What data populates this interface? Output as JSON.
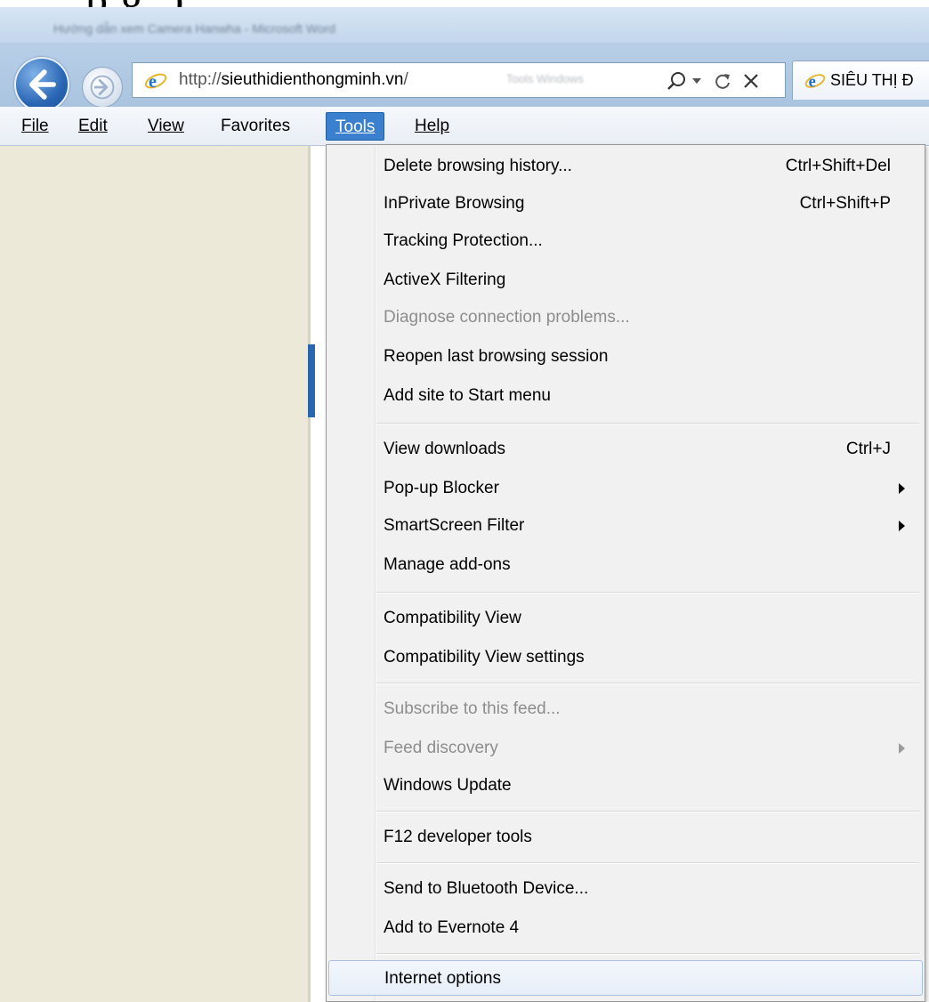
{
  "window": {
    "title": "Hướng dẫn xem Camera Hanwha - Microsoft Word",
    "caption_fragment": "p                                                      g              ;)"
  },
  "address_bar": {
    "url_prefix": "http://",
    "url_domain": "sieuthidienthongminh.vn",
    "url_suffix": "/",
    "blurred_text": "Tools     Windows"
  },
  "tab": {
    "label": "SIÊU THỊ Đ"
  },
  "menubar": {
    "file": "File",
    "edit": "Edit",
    "view": "View",
    "favorites": "Favorites",
    "tools": "Tools",
    "help": "Help"
  },
  "tools_menu": {
    "items": [
      {
        "label": "Delete browsing history...",
        "shortcut": "Ctrl+Shift+Del",
        "disabled": false
      },
      {
        "label": "InPrivate Browsing",
        "shortcut": "Ctrl+Shift+P",
        "disabled": false
      },
      {
        "label": "Tracking Protection...",
        "shortcut": "",
        "disabled": false
      },
      {
        "label": "ActiveX Filtering",
        "shortcut": "",
        "disabled": false
      },
      {
        "label": "Diagnose connection problems...",
        "shortcut": "",
        "disabled": true
      },
      {
        "label": "Reopen last browsing session",
        "shortcut": "",
        "disabled": false
      },
      {
        "label": "Add site to Start menu",
        "shortcut": "",
        "disabled": false
      },
      {
        "label": "View downloads",
        "shortcut": "Ctrl+J",
        "disabled": false
      },
      {
        "label": "Pop-up Blocker",
        "shortcut": "",
        "submenu": true,
        "disabled": false
      },
      {
        "label": "SmartScreen Filter",
        "shortcut": "",
        "submenu": true,
        "disabled": false
      },
      {
        "label": "Manage add-ons",
        "shortcut": "",
        "disabled": false
      },
      {
        "label": "Compatibility View",
        "shortcut": "",
        "disabled": false
      },
      {
        "label": "Compatibility View settings",
        "shortcut": "",
        "disabled": false
      },
      {
        "label": "Subscribe to this feed...",
        "shortcut": "",
        "disabled": true
      },
      {
        "label": "Feed discovery",
        "shortcut": "",
        "submenu": true,
        "disabled": true
      },
      {
        "label": "Windows Update",
        "shortcut": "",
        "disabled": false
      },
      {
        "label": "F12 developer tools",
        "shortcut": "",
        "disabled": false
      },
      {
        "label": "Send to Bluetooth Device...",
        "shortcut": "",
        "disabled": false
      },
      {
        "label": "Add to Evernote 4",
        "shortcut": "",
        "disabled": false
      },
      {
        "label": "Internet options",
        "shortcut": "",
        "disabled": false,
        "highlighted": true
      }
    ]
  },
  "colors": {
    "menu_active": "#3b7fcf",
    "left_panel": "#ece9d8",
    "menu_background": "#f1f1f1",
    "disabled_text": "#8d8d8d"
  }
}
